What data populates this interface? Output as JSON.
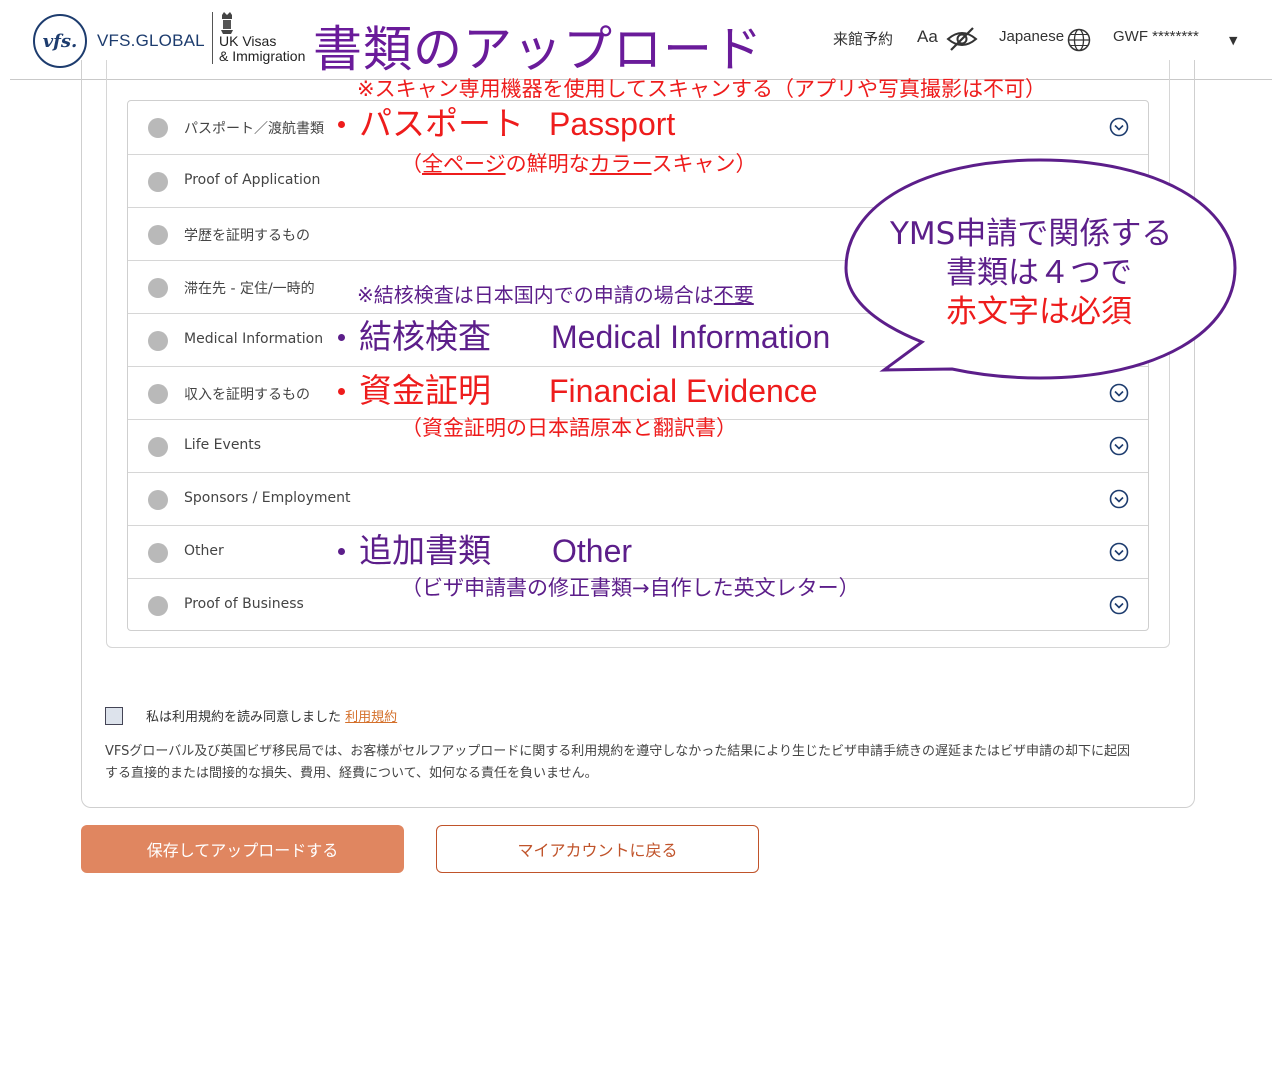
{
  "header": {
    "logo_mark": "vfs.",
    "logo_text": "VFS.GLOBAL",
    "partner_line1": "UK Visas",
    "partner_line2": "& Immigration",
    "page_title": "書類のアップロード",
    "nav_booking": "来館予約",
    "nav_text_size": "Aa",
    "nav_language": "Japanese",
    "nav_user": "GWF ********",
    "icons": [
      "crest-icon",
      "eye-slash-icon",
      "globe-icon",
      "caret-down-icon"
    ]
  },
  "documents": [
    {
      "label": "パスポート／渡航書類"
    },
    {
      "label": "Proof of Application"
    },
    {
      "label": "学歴を証明するもの"
    },
    {
      "label": "滞在先 - 定住/一時的"
    },
    {
      "label": "Medical Information"
    },
    {
      "label": "収入を証明するもの"
    },
    {
      "label": "Life Events"
    },
    {
      "label": "Sponsors / Employment"
    },
    {
      "label": "Other"
    },
    {
      "label": "Proof of Business"
    }
  ],
  "annotations": {
    "scan_note": "※スキャン専用機器を使用してスキャンする（アプリや写真撮影は不可）",
    "passport_ja": "パスポート",
    "passport_en": "Passport",
    "passport_sub_pre": "（",
    "passport_sub_u1": "全ページ",
    "passport_sub_mid": "の鮮明な",
    "passport_sub_u2": "カラー",
    "passport_sub_post": "スキャン）",
    "tb_note_pre": "※結核検査は日本国内での申請の場合は",
    "tb_note_u": "不要",
    "medical_ja": "結核検査",
    "medical_en": "Medical Information",
    "finance_ja": "資金証明",
    "finance_en": "Financial Evidence",
    "finance_sub": "（資金証明の日本語原本と翻訳書）",
    "other_ja": "追加書類",
    "other_en": "Other",
    "other_sub": "（ビザ申請書の修正書類→自作した英文レター）",
    "bubble_line1": "YMS申請で関係する",
    "bubble_line2": "書類は４つで",
    "bubble_line3": "赤文字は必須"
  },
  "terms": {
    "checkbox_label": "私は利用規約を読み同意しました",
    "link_text": "利用規約",
    "disclaimer": "VFSグローバル及び英国ビザ移民局では、お客様がセルフアップロードに関する利用規約を遵守しなかった結果により生じたビザ申請手続きの遅延またはビザ申請の却下に起因する直接的または間接的な損失、費用、経費について、如何なる責任を負いません。"
  },
  "actions": {
    "save_upload": "保存してアップロードする",
    "back_account": "マイアカウントに戻る"
  },
  "colors": {
    "brand_navy": "#1d3c6e",
    "title_purple": "#6a1b9a",
    "annotation_red": "#ee1c1c",
    "annotation_purple": "#5c1e8a",
    "primary_button": "#e08660",
    "secondary_border": "#c0532a"
  }
}
